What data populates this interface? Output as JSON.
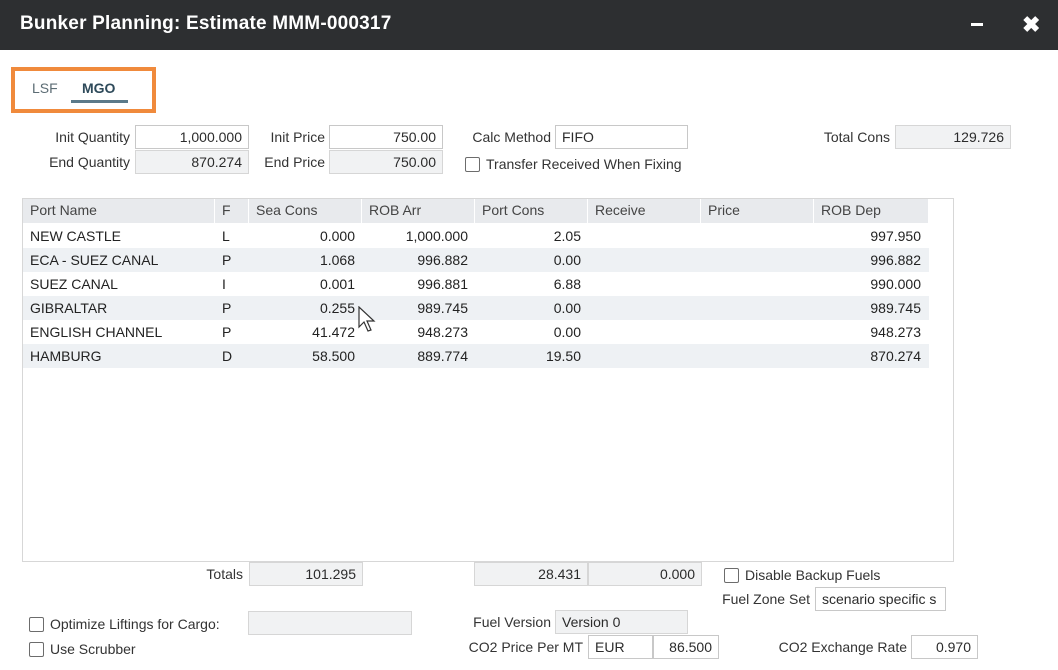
{
  "window": {
    "title": "Bunker Planning: Estimate MMM-000317",
    "minimize_icon": "minimize-icon",
    "close_icon": "close-icon",
    "close_glyph": "✖"
  },
  "tabs": [
    {
      "label": "LSF",
      "active": false
    },
    {
      "label": "MGO",
      "active": true
    }
  ],
  "accent_colors": {
    "tab_highlight": "#f08a3c",
    "titlebar": "#2d2f31"
  },
  "form": {
    "init_quantity_label": "Init Quantity",
    "init_quantity": "1,000.000",
    "end_quantity_label": "End Quantity",
    "end_quantity": "870.274",
    "init_price_label": "Init Price",
    "init_price": "750.00",
    "end_price_label": "End Price",
    "end_price": "750.00",
    "calc_method_label": "Calc Method",
    "calc_method": "FIFO",
    "transfer_label": "Transfer Received When Fixing",
    "transfer_checked": false,
    "total_cons_label": "Total Cons",
    "total_cons": "129.726"
  },
  "grid": {
    "columns": [
      "Port Name",
      "F",
      "Sea Cons",
      "ROB Arr",
      "Port Cons",
      "Receive",
      "Price",
      "ROB Dep"
    ],
    "rows": [
      {
        "port": "NEW CASTLE",
        "f": "L",
        "sea_cons": "0.000",
        "rob_arr": "1,000.000",
        "port_cons": "2.05",
        "receive": "",
        "price": "",
        "rob_dep": "997.950"
      },
      {
        "port": "ECA - SUEZ CANAL",
        "f": "P",
        "sea_cons": "1.068",
        "rob_arr": "996.882",
        "port_cons": "0.00",
        "receive": "",
        "price": "",
        "rob_dep": "996.882"
      },
      {
        "port": "SUEZ CANAL",
        "f": "I",
        "sea_cons": "0.001",
        "rob_arr": "996.881",
        "port_cons": "6.88",
        "receive": "",
        "price": "",
        "rob_dep": "990.000"
      },
      {
        "port": "GIBRALTAR",
        "f": "P",
        "sea_cons": "0.255",
        "rob_arr": "989.745",
        "port_cons": "0.00",
        "receive": "",
        "price": "",
        "rob_dep": "989.745"
      },
      {
        "port": "ENGLISH CHANNEL",
        "f": "P",
        "sea_cons": "41.472",
        "rob_arr": "948.273",
        "port_cons": "0.00",
        "receive": "",
        "price": "",
        "rob_dep": "948.273"
      },
      {
        "port": "HAMBURG",
        "f": "D",
        "sea_cons": "58.500",
        "rob_arr": "889.774",
        "port_cons": "19.50",
        "receive": "",
        "price": "",
        "rob_dep": "870.274"
      }
    ]
  },
  "totals": {
    "label": "Totals",
    "sea_cons": "101.295",
    "port_cons": "28.431",
    "receive": "0.000"
  },
  "footer": {
    "disable_backup_label": "Disable Backup Fuels",
    "disable_backup_checked": false,
    "fuel_zone_label": "Fuel Zone Set",
    "fuel_zone": "scenario specific s",
    "optimize_label": "Optimize Liftings for Cargo:",
    "optimize_checked": false,
    "optimize_value": "",
    "use_scrubber_label": "Use Scrubber",
    "use_scrubber_checked": false,
    "fuel_version_label": "Fuel Version",
    "fuel_version": "Version 0",
    "co2_price_label": "CO2 Price Per MT",
    "co2_currency": "EUR",
    "co2_price": "86.500",
    "co2_rate_label": "CO2 Exchange Rate",
    "co2_rate": "0.970"
  },
  "cursor_icon": "mouse-pointer-icon"
}
